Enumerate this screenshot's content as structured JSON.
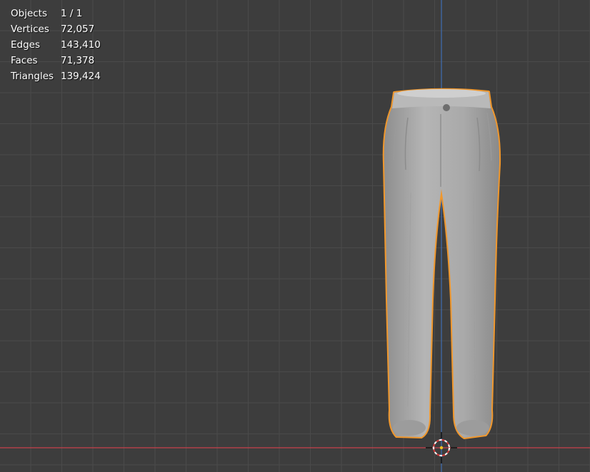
{
  "stats": {
    "objects_label": "Objects",
    "objects_value": "1 / 1",
    "vertices_label": "Vertices",
    "vertices_value": "72,057",
    "edges_label": "Edges",
    "edges_value": "143,410",
    "faces_label": "Faces",
    "faces_value": "71,378",
    "triangles_label": "Triangles",
    "triangles_value": "139,424"
  },
  "colors": {
    "background": "#3d3d3d",
    "grid": "#4a4a4a",
    "x_axis": "#c8414b",
    "z_axis": "#3f6fb3",
    "selection_outline": "#f0972c",
    "mesh": "#a8a8a8"
  },
  "icons": {
    "cursor": "3d-cursor-icon",
    "object": "trousers-mesh"
  }
}
